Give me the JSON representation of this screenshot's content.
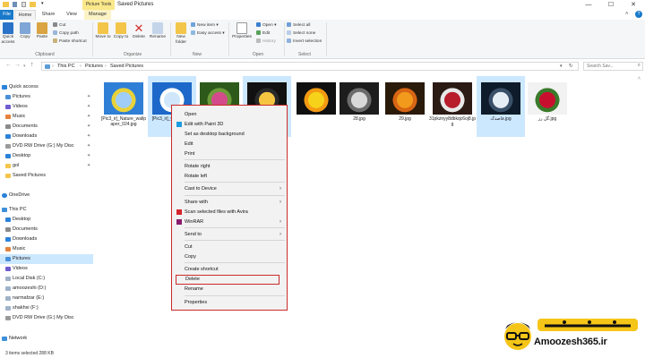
{
  "window": {
    "title": "Saved Pictures",
    "context_tab": "Picture Tools",
    "controls": {
      "minimize": "—",
      "maximize": "☐",
      "close": "✕"
    }
  },
  "ribbon_tabs": [
    "File",
    "Home",
    "Share",
    "View",
    "Manage"
  ],
  "ribbon": {
    "clipboard": {
      "quick_access": "Quick access",
      "copy": "Copy",
      "paste": "Paste",
      "cut": "Cut",
      "copy_path": "Copy path",
      "paste_shortcut": "Paste shortcut",
      "label": "Clipboard"
    },
    "organize": {
      "move_to": "Move to",
      "copy_to": "Copy to",
      "delete": "Delete",
      "rename": "Rename",
      "label": "Organize"
    },
    "new": {
      "new_folder": "New folder",
      "new_item": "New item",
      "easy_access": "Easy access",
      "label": "New"
    },
    "open": {
      "properties": "Properties",
      "open": "Open",
      "edit": "Edit",
      "history": "History",
      "label": "Open"
    },
    "select": {
      "select_all": "Select all",
      "select_none": "Select none",
      "invert_selection": "Invert selection",
      "label": "Select"
    }
  },
  "address": {
    "crumbs": [
      "This PC",
      "Pictures",
      "Saved Pictures"
    ],
    "search_placeholder": "Search Sav..."
  },
  "nav": {
    "quick_access": "Quick access",
    "items": [
      {
        "label": "Pictures"
      },
      {
        "label": "Videos"
      },
      {
        "label": "Music"
      },
      {
        "label": "Documents"
      },
      {
        "label": "Downloads"
      },
      {
        "label": "DVD RW Drive (G:) My Disc"
      },
      {
        "label": "Desktop"
      },
      {
        "label": "gol"
      },
      {
        "label": "Saved Pictures"
      }
    ],
    "onedrive": "OneDrive",
    "this_pc": "This PC",
    "pc_items": [
      {
        "label": "Desktop"
      },
      {
        "label": "Documents"
      },
      {
        "label": "Downloads"
      },
      {
        "label": "Music"
      },
      {
        "label": "Pictures"
      },
      {
        "label": "Videos"
      },
      {
        "label": "Local Disk (C:)"
      },
      {
        "label": "amoozeshi (D:)"
      },
      {
        "label": "narmafzar (E:)"
      },
      {
        "label": "shakhsi (F:)"
      },
      {
        "label": "DVD RW Drive (G:) My Disc"
      }
    ],
    "network": "Network"
  },
  "files": [
    {
      "name": "[Pic3_ir]_Nature_wallpaper_024.jpg",
      "colors": [
        "#2f7fd6",
        "#9fcdf7",
        "#e8d23a"
      ]
    },
    {
      "name": "[Pic3_ir]_wallpape g",
      "colors": [
        "#1d68c9",
        "#cfe6fb",
        "#ffffff"
      ]
    },
    {
      "name": "",
      "colors": [
        "#2d5a1a",
        "#d44b8c",
        "#6e9b3a"
      ]
    },
    {
      "name": "",
      "colors": [
        "#111111",
        "#f5c542",
        "#2a2a2a"
      ]
    },
    {
      "name": "",
      "colors": [
        "#101010",
        "#f7d21b",
        "#f39a12"
      ]
    },
    {
      "name": "28.jpg",
      "colors": [
        "#1d1d1d",
        "#d9d9d9",
        "#6b6b6b"
      ]
    },
    {
      "name": "29.jpg",
      "colors": [
        "#2a1a0a",
        "#f29a1c",
        "#d86514"
      ]
    },
    {
      "name": "31pkznyy8dbkqc6oj8.jpg",
      "colors": [
        "#2b1b14",
        "#b71d2b",
        "#e8e8e8"
      ]
    },
    {
      "name": "قاصدک.jpg",
      "colors": [
        "#0d1b2a",
        "#e6eef5",
        "#3a5068"
      ]
    },
    {
      "name": "گل رز.jpg",
      "colors": [
        "#f2f2f2",
        "#c8102e",
        "#3a7a2a"
      ]
    }
  ],
  "context_menu": {
    "items": [
      {
        "label": "Open"
      },
      {
        "label": "Edit with Paint 3D"
      },
      {
        "label": "Set as desktop background"
      },
      {
        "label": "Edit"
      },
      {
        "label": "Print"
      },
      {
        "label": "Rotate right"
      },
      {
        "label": "Rotate left"
      },
      {
        "label": "Cast to Device"
      },
      {
        "label": "Share with"
      },
      {
        "label": "Scan selected files with Avira"
      },
      {
        "label": "WinRAR"
      },
      {
        "label": "Send to"
      },
      {
        "label": "Cut"
      },
      {
        "label": "Copy"
      },
      {
        "label": "Create shortcut"
      },
      {
        "label": "Delete"
      },
      {
        "label": "Rename"
      },
      {
        "label": "Properties"
      }
    ]
  },
  "status": {
    "item_count": "3 items selected  288 KB"
  },
  "watermark": {
    "url": "Amoozesh365.ir",
    "fa_text": "آموزش ۳۶۵"
  },
  "colors": {
    "selection": "#cce8ff",
    "highlight_border": "#cc2a2a",
    "file_tab": "#1979ca",
    "context_tab": "#fbe88a"
  }
}
